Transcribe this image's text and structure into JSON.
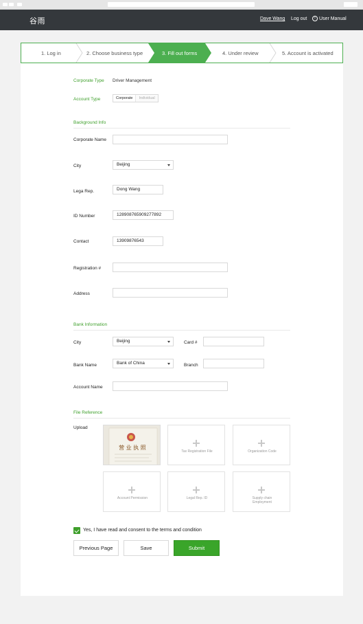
{
  "app": {
    "logo": "谷雨",
    "user_name": "Dave Wang",
    "logout_label": "Log out",
    "manual_label": "User Manual"
  },
  "steps": [
    {
      "label": "1. Log in",
      "state": "done"
    },
    {
      "label": "2. Choose business type",
      "state": "done"
    },
    {
      "label": "3. Fill out forms",
      "state": "active"
    },
    {
      "label": "4. Under review",
      "state": "pending"
    },
    {
      "label": "5. Account is activated",
      "state": "pending"
    }
  ],
  "form": {
    "corporate_type": {
      "label": "Corporate Type",
      "value": "Driver Management"
    },
    "account_type": {
      "label": "Account Type",
      "options": [
        "Corporate",
        "Individual"
      ],
      "selected": "Corporate"
    },
    "background": {
      "title": "Background Info",
      "corporate_name": {
        "label": "Corporate Name",
        "value": ""
      },
      "city": {
        "label": "City",
        "value": "Beijing"
      },
      "legal_rep": {
        "label": "Lega Rep.",
        "value": "Dong Wang"
      },
      "id_number": {
        "label": "ID Number",
        "value": "128908765909277892"
      },
      "contact": {
        "label": "Contact",
        "value": "13909876543"
      },
      "registration": {
        "label": "Registration #",
        "value": ""
      },
      "address": {
        "label": "Address",
        "value": ""
      }
    },
    "bank": {
      "title": "Bank Information",
      "city": {
        "label": "City",
        "value": "Beijing"
      },
      "card": {
        "label": "Card #",
        "value": ""
      },
      "bank_name": {
        "label": "Bank Name",
        "value": "Bank of China"
      },
      "branch": {
        "label": "Branch",
        "value": ""
      },
      "account_name": {
        "label": "Account Name",
        "value": ""
      }
    },
    "files": {
      "title": "File Reference",
      "upload_label": "Upload",
      "license_title": "营 业 执 照",
      "slots": [
        "Tax Registration File",
        "Organization Code",
        "Account Permission",
        "Legal Rep. ID",
        "Supply chain",
        "Employment"
      ]
    },
    "consent": "Yes, I have read and consent to the terms and condition",
    "consent_checked": true,
    "buttons": {
      "previous": "Previous Page",
      "save": "Save",
      "submit": "Submit"
    }
  },
  "colors": {
    "accent": "#3aa52a",
    "header": "#34383c",
    "active_step": "#4caf50"
  }
}
